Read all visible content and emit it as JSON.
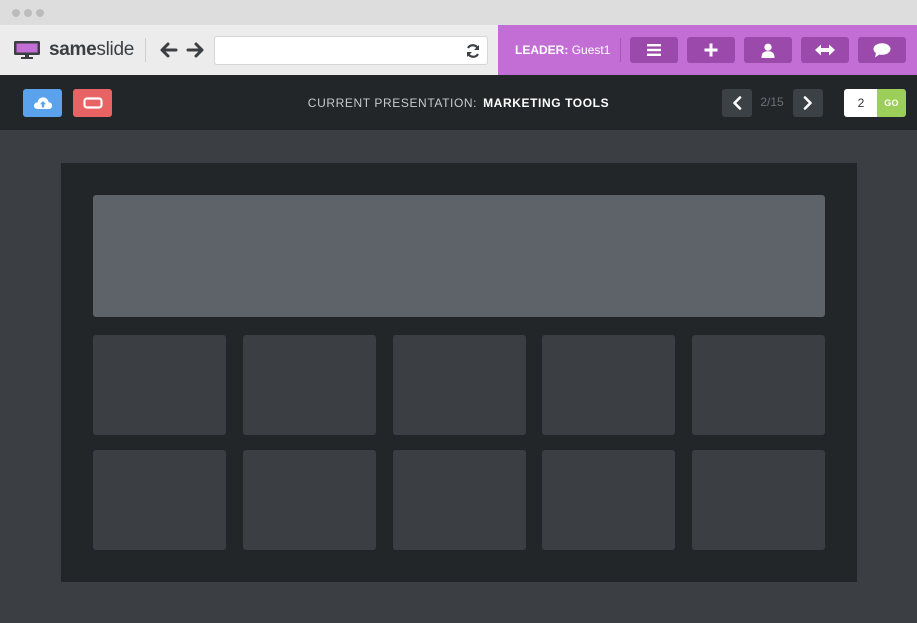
{
  "app": {
    "name_bold": "same",
    "name_light": "slide"
  },
  "browser": {
    "url_value": "",
    "url_placeholder": ""
  },
  "leader": {
    "label": "LEADER:",
    "name": "Guest1",
    "buttons": [
      {
        "icon": "menu-icon"
      },
      {
        "icon": "plus-icon"
      },
      {
        "icon": "user-icon"
      },
      {
        "icon": "swap-arrows-icon"
      },
      {
        "icon": "chat-icon"
      }
    ]
  },
  "presentation": {
    "label": "CURRENT PRESENTATION:",
    "name": "MARKETING TOOLS",
    "page_count": "2/15",
    "goto_value": "2",
    "go_label": "GO"
  },
  "colors": {
    "accent_purple": "#c36ed4",
    "upload_blue": "#5aa3ec",
    "stop_red": "#e86363",
    "go_green": "#9ccf5a"
  }
}
